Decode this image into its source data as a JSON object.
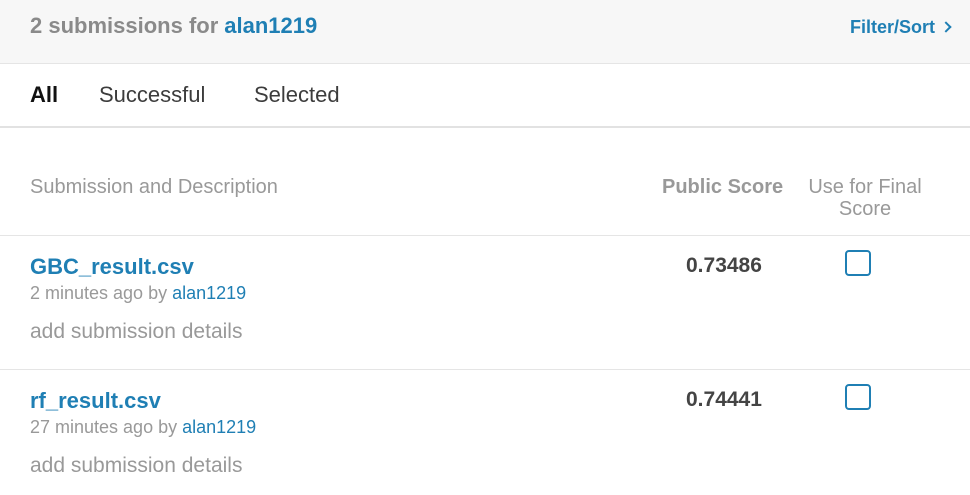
{
  "header": {
    "count_text": "2 submissions for",
    "username": "alan1219",
    "filter_sort_label": "Filter/Sort",
    "filter_sort_icon": "chevron-right-icon"
  },
  "tabs": [
    {
      "label": "All",
      "active": true
    },
    {
      "label": "Successful",
      "active": false
    },
    {
      "label": "Selected",
      "active": false
    }
  ],
  "table": {
    "headers": {
      "description": "Submission and Description",
      "public_score": "Public Score",
      "final_score": "Use for Final Score"
    },
    "rows": [
      {
        "file_name": "GBC_result.csv",
        "time_ago": "2 minutes ago by",
        "user": "alan1219",
        "details_label": "add submission details",
        "public_score": "0.73486",
        "selected_for_final": false
      },
      {
        "file_name": "rf_result.csv",
        "time_ago": "27 minutes ago by",
        "user": "alan1219",
        "details_label": "add submission details",
        "public_score": "0.74441",
        "selected_for_final": false
      }
    ]
  },
  "colors": {
    "link": "#1f7fb4",
    "muted": "#999999",
    "header_bg": "#f7f7f7"
  }
}
